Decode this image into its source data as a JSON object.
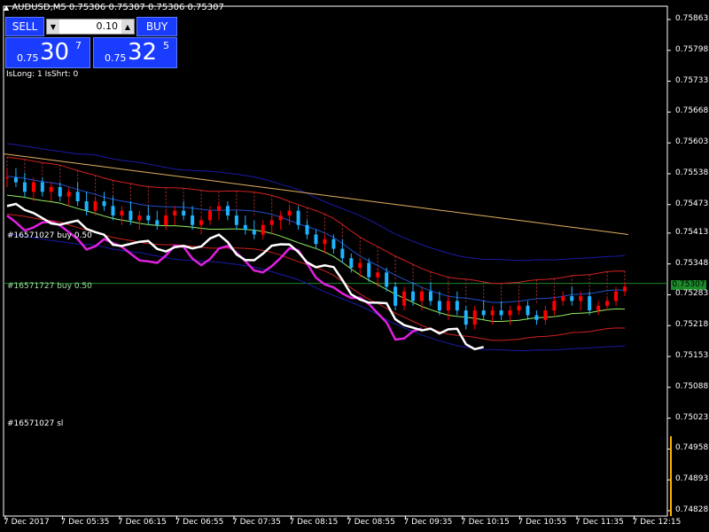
{
  "header": {
    "symbol_line": "AUDUSD,M5  0.75306 0.75307 0.75306 0.75307"
  },
  "trade_panel": {
    "sell_label": "SELL",
    "buy_label": "BUY",
    "lot_value": "0.10",
    "sell_prefix": "0.75",
    "sell_big": "30",
    "sell_sup": "7",
    "buy_prefix": "0.75",
    "buy_big": "32",
    "buy_sup": "5",
    "accent_color": "#1a3cff"
  },
  "status_text": "IsLong: 1 IsShrt: 0",
  "order_labels": {
    "buy1": "#16571027 buy 0.50",
    "buy2": "#16571727 buy 0.50",
    "sl": "#16571027 sl"
  },
  "current_price": "0.75307",
  "chart_data": {
    "type": "line",
    "y_ticks": [
      "0.75863",
      "0.75798",
      "0.75733",
      "0.75668",
      "0.75603",
      "0.75538",
      "0.75473",
      "0.75413",
      "0.75348",
      "0.75283",
      "0.75218",
      "0.75153",
      "0.75088",
      "0.75023",
      "0.74958",
      "0.74893",
      "0.74828"
    ],
    "x_ticks": [
      "7 Dec 2017",
      "7 Dec 05:35",
      "7 Dec 06:15",
      "7 Dec 06:55",
      "7 Dec 07:35",
      "7 Dec 08:15",
      "7 Dec 08:55",
      "7 Dec 09:35",
      "7 Dec 10:15",
      "7 Dec 10:55",
      "7 Dec 11:35",
      "7 Dec 12:15"
    ],
    "ylim": [
      0.74828,
      0.75863
    ],
    "current_price": 0.75307,
    "candles": [
      [
        0.7553,
        0.7555,
        0.7551,
        0.7553
      ],
      [
        0.7553,
        0.7555,
        0.7551,
        0.7552
      ],
      [
        0.7552,
        0.7554,
        0.7549,
        0.755
      ],
      [
        0.755,
        0.7553,
        0.7548,
        0.7552
      ],
      [
        0.7552,
        0.7553,
        0.7549,
        0.755
      ],
      [
        0.755,
        0.7552,
        0.7548,
        0.7551
      ],
      [
        0.7551,
        0.7552,
        0.7548,
        0.7549
      ],
      [
        0.7549,
        0.7551,
        0.7547,
        0.755
      ],
      [
        0.755,
        0.7552,
        0.7547,
        0.7548
      ],
      [
        0.7548,
        0.755,
        0.7545,
        0.7546
      ],
      [
        0.7546,
        0.7549,
        0.7545,
        0.7548
      ],
      [
        0.7548,
        0.755,
        0.7546,
        0.7547
      ],
      [
        0.7547,
        0.7549,
        0.7544,
        0.7545
      ],
      [
        0.7545,
        0.7547,
        0.7543,
        0.7546
      ],
      [
        0.7546,
        0.7548,
        0.7543,
        0.7544
      ],
      [
        0.7544,
        0.7546,
        0.7542,
        0.7545
      ],
      [
        0.7545,
        0.7547,
        0.7543,
        0.7544
      ],
      [
        0.7544,
        0.7546,
        0.7542,
        0.7543
      ],
      [
        0.7543,
        0.7546,
        0.7542,
        0.7545
      ],
      [
        0.7545,
        0.7547,
        0.7543,
        0.7546
      ],
      [
        0.7546,
        0.7548,
        0.7544,
        0.7545
      ],
      [
        0.7545,
        0.7547,
        0.7542,
        0.7543
      ],
      [
        0.7543,
        0.7545,
        0.7541,
        0.7544
      ],
      [
        0.7544,
        0.7547,
        0.7543,
        0.7546
      ],
      [
        0.7546,
        0.7548,
        0.7544,
        0.7547
      ],
      [
        0.7547,
        0.7548,
        0.7544,
        0.7545
      ],
      [
        0.7545,
        0.7546,
        0.7542,
        0.7543
      ],
      [
        0.7543,
        0.7545,
        0.7541,
        0.7542
      ],
      [
        0.7542,
        0.7544,
        0.754,
        0.7541
      ],
      [
        0.7541,
        0.7544,
        0.754,
        0.7543
      ],
      [
        0.7543,
        0.7545,
        0.7541,
        0.7544
      ],
      [
        0.7544,
        0.7546,
        0.7542,
        0.7545
      ],
      [
        0.7545,
        0.7547,
        0.7543,
        0.7546
      ],
      [
        0.7546,
        0.7547,
        0.7542,
        0.7543
      ],
      [
        0.7543,
        0.7544,
        0.754,
        0.7541
      ],
      [
        0.7541,
        0.7542,
        0.7538,
        0.7539
      ],
      [
        0.7539,
        0.7541,
        0.7537,
        0.754
      ],
      [
        0.754,
        0.7541,
        0.7537,
        0.7538
      ],
      [
        0.7538,
        0.754,
        0.7535,
        0.7536
      ],
      [
        0.7536,
        0.7537,
        0.7533,
        0.7534
      ],
      [
        0.7534,
        0.7536,
        0.7532,
        0.7535
      ],
      [
        0.7535,
        0.7536,
        0.7531,
        0.7532
      ],
      [
        0.7532,
        0.7534,
        0.753,
        0.7533
      ],
      [
        0.7533,
        0.7534,
        0.7529,
        0.753
      ],
      [
        0.753,
        0.7531,
        0.7525,
        0.7526
      ],
      [
        0.7526,
        0.753,
        0.7525,
        0.7529
      ],
      [
        0.7529,
        0.7531,
        0.7526,
        0.7527
      ],
      [
        0.7527,
        0.753,
        0.7525,
        0.7529
      ],
      [
        0.7529,
        0.7531,
        0.7526,
        0.7527
      ],
      [
        0.7527,
        0.7529,
        0.7524,
        0.7525
      ],
      [
        0.7525,
        0.7528,
        0.7523,
        0.7527
      ],
      [
        0.7527,
        0.7529,
        0.7524,
        0.7525
      ],
      [
        0.7525,
        0.7526,
        0.7521,
        0.7522
      ],
      [
        0.7522,
        0.7526,
        0.7521,
        0.7525
      ],
      [
        0.7525,
        0.7527,
        0.7523,
        0.7524
      ],
      [
        0.7524,
        0.7526,
        0.7522,
        0.7525
      ],
      [
        0.7525,
        0.7527,
        0.7523,
        0.7524
      ],
      [
        0.7524,
        0.7526,
        0.7522,
        0.7525
      ],
      [
        0.7525,
        0.7527,
        0.7524,
        0.7526
      ],
      [
        0.7526,
        0.7527,
        0.7523,
        0.7524
      ],
      [
        0.7524,
        0.7525,
        0.7522,
        0.7523
      ],
      [
        0.7523,
        0.7526,
        0.7522,
        0.7525
      ],
      [
        0.7525,
        0.7528,
        0.7524,
        0.7527
      ],
      [
        0.7527,
        0.7529,
        0.7526,
        0.7528
      ],
      [
        0.7528,
        0.753,
        0.7526,
        0.7527
      ],
      [
        0.7527,
        0.7529,
        0.7525,
        0.7528
      ],
      [
        0.7528,
        0.7529,
        0.7524,
        0.7525
      ],
      [
        0.7525,
        0.7527,
        0.7524,
        0.7526
      ],
      [
        0.7526,
        0.7528,
        0.7525,
        0.7527
      ],
      [
        0.7527,
        0.753,
        0.7526,
        0.7529
      ],
      [
        0.7529,
        0.7531,
        0.7528,
        0.753
      ]
    ],
    "bull_color": "#ff0000",
    "bear_color": "#1fb4ff"
  }
}
